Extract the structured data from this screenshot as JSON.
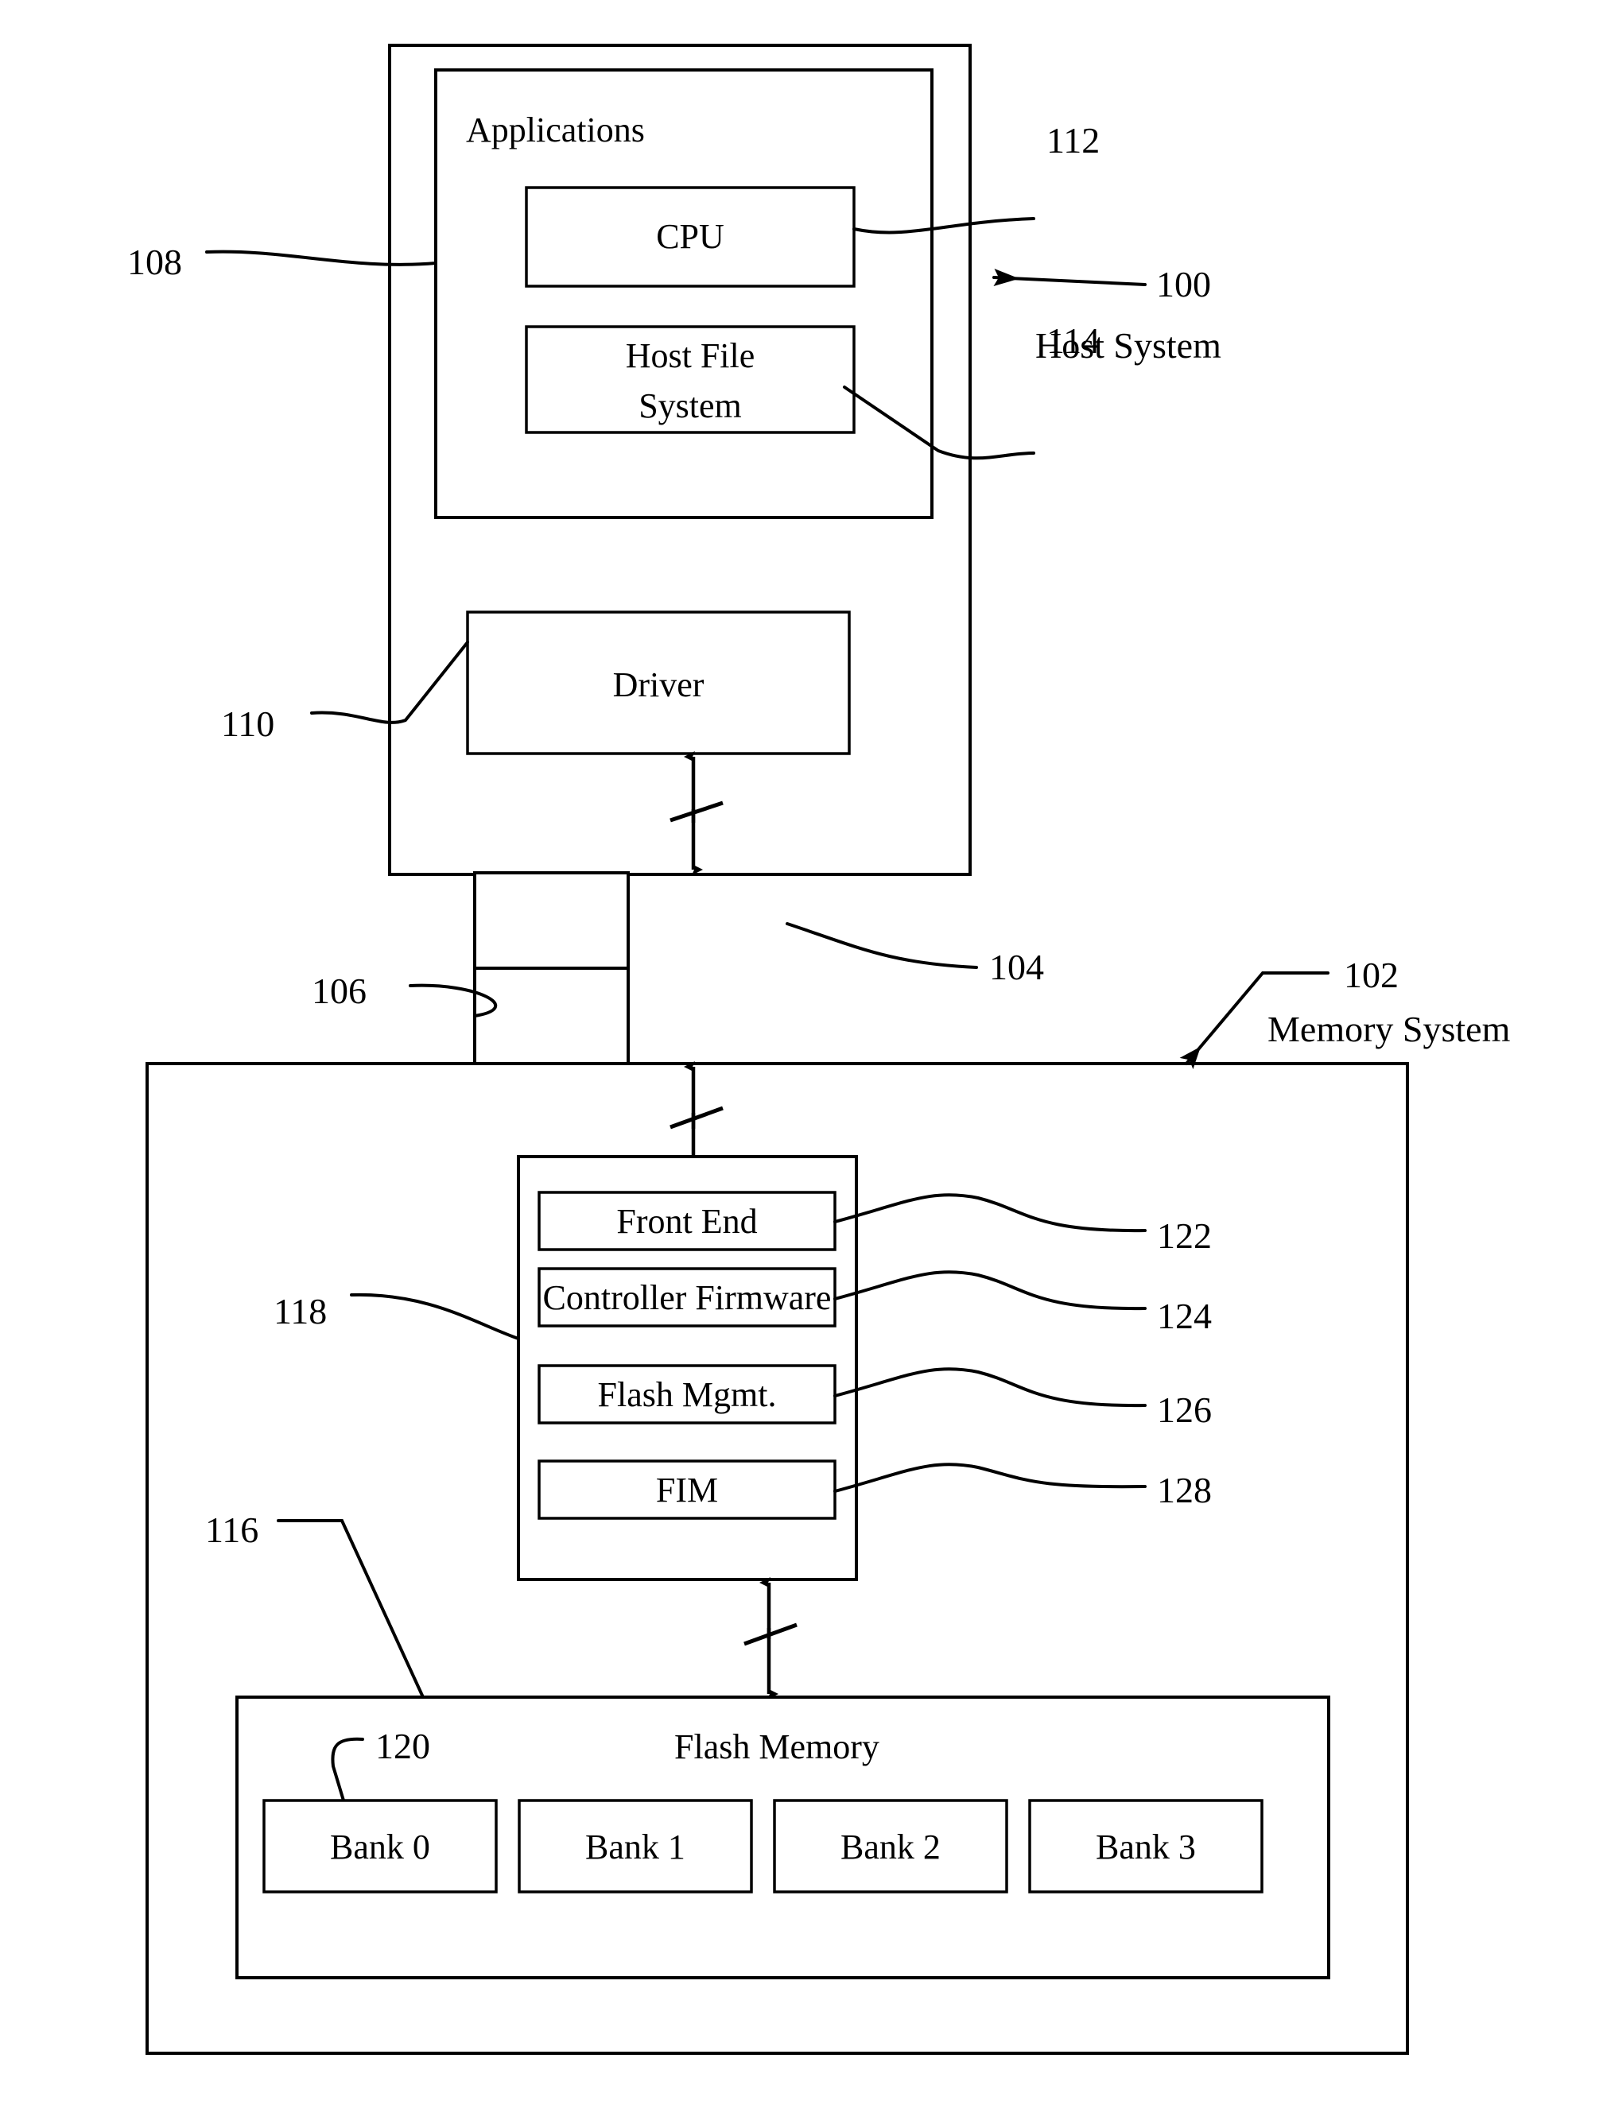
{
  "figure": {
    "host_system": {
      "label": "Host System",
      "ref": "100",
      "applications": {
        "label": "Applications",
        "ref": "108",
        "cpu": {
          "label": "CPU",
          "ref": "112"
        },
        "host_file_system": {
          "label": "Host File\nSystem",
          "line1": "Host File",
          "line2": "System",
          "ref": "114"
        }
      },
      "driver": {
        "label": "Driver",
        "ref": "110"
      }
    },
    "interface": {
      "host_side_ref": "104",
      "memory_side_ref": "106"
    },
    "memory_system": {
      "label": "Memory System",
      "ref": "102",
      "controller": {
        "ref": "118",
        "modules": [
          {
            "label": "Front End",
            "ref": "122"
          },
          {
            "label": "Controller Firmware",
            "ref": "124"
          },
          {
            "label": "Flash Mgmt.",
            "ref": "126"
          },
          {
            "label": "FIM",
            "ref": "128"
          }
        ]
      },
      "flash_memory": {
        "label": "Flash Memory",
        "ref": "116",
        "bank_ref": "120",
        "banks": [
          {
            "label": "Bank 0"
          },
          {
            "label": "Bank 1"
          },
          {
            "label": "Bank 2"
          },
          {
            "label": "Bank 3"
          }
        ]
      }
    }
  },
  "colors": {
    "ink": "#000000",
    "paper": "#ffffff"
  }
}
